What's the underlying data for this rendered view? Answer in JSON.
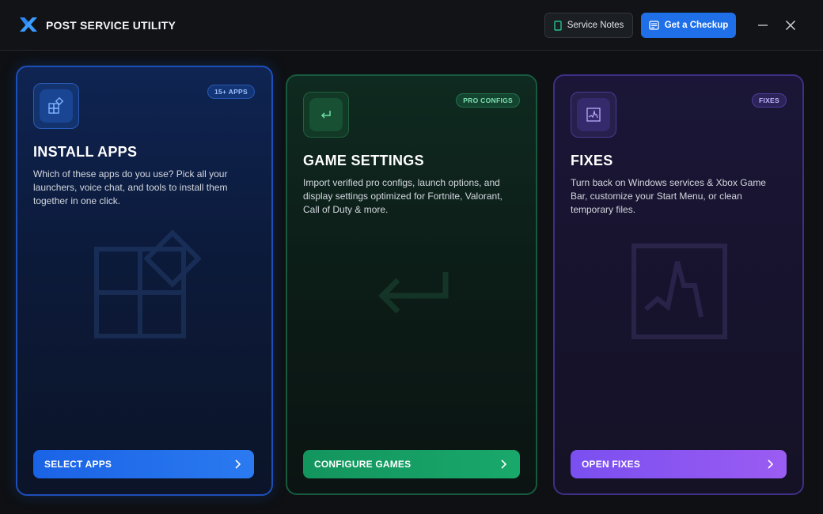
{
  "app": {
    "title": "POST SERVICE UTILITY",
    "logo_icon": "x-logo-icon"
  },
  "header": {
    "notes_label": "Service Notes",
    "notes_icon": "notebook-icon",
    "checkup_label": "Get a Checkup",
    "checkup_icon": "clipboard-icon",
    "minimize_icon": "minimize-icon",
    "close_icon": "close-icon"
  },
  "cards": [
    {
      "id": "install-apps",
      "badge": "15+ APPS",
      "title": "INSTALL APPS",
      "description": "Which of these apps do you use? Pick all your launchers, voice chat, and tools to install them together in one click.",
      "button_label": "SELECT APPS",
      "icon": "apps-grid-icon",
      "accent": "#1f6fe8"
    },
    {
      "id": "game-settings",
      "badge": "PRO CONFIGS",
      "title": "GAME SETTINGS",
      "description": "Import verified pro configs, launch options, and display settings optimized for Fortnite, Valorant, Call of Duty & more.",
      "button_label": "CONFIGURE GAMES",
      "icon": "enter-arrow-icon",
      "accent": "#19a86b"
    },
    {
      "id": "fixes",
      "badge": "FIXES",
      "title": "FIXES",
      "description": "Turn back on Windows services & Xbox Game Bar, customize your Start Menu, or clean temporary files.",
      "button_label": "OPEN FIXES",
      "icon": "activity-chart-icon",
      "accent": "#8b55f2"
    }
  ]
}
